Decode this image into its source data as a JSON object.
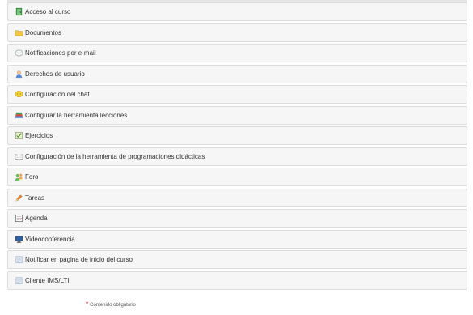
{
  "items": [
    {
      "label": "Acceso al curso",
      "icon": "door-icon"
    },
    {
      "label": "Documentos",
      "icon": "folder-icon"
    },
    {
      "label": "Notificaciones por e-mail",
      "icon": "mail-icon"
    },
    {
      "label": "Derechos de usuario",
      "icon": "user-icon"
    },
    {
      "label": "Configuración del chat",
      "icon": "chat-icon"
    },
    {
      "label": "Configurar la herramienta lecciones",
      "icon": "books-icon"
    },
    {
      "label": "Ejercicios",
      "icon": "quiz-icon"
    },
    {
      "label": "Configuración de la herramienta de programaciones didácticas",
      "icon": "open-book-icon"
    },
    {
      "label": "Foro",
      "icon": "forum-icon"
    },
    {
      "label": "Tareas",
      "icon": "pencil-icon"
    },
    {
      "label": "Agenda",
      "icon": "agenda-icon"
    },
    {
      "label": "Videoconferencia",
      "icon": "monitor-icon"
    },
    {
      "label": "Notificar en página de inicio del curso",
      "icon": "page-icon"
    },
    {
      "label": "Cliente IMS/LTI",
      "icon": "page-icon"
    }
  ],
  "footnote": {
    "star": "*",
    "text": "Contenido obligatorio"
  },
  "colors": {
    "row_bg": "#f6f6f6",
    "row_border": "#dcdcdc",
    "required": "#cc0000"
  }
}
